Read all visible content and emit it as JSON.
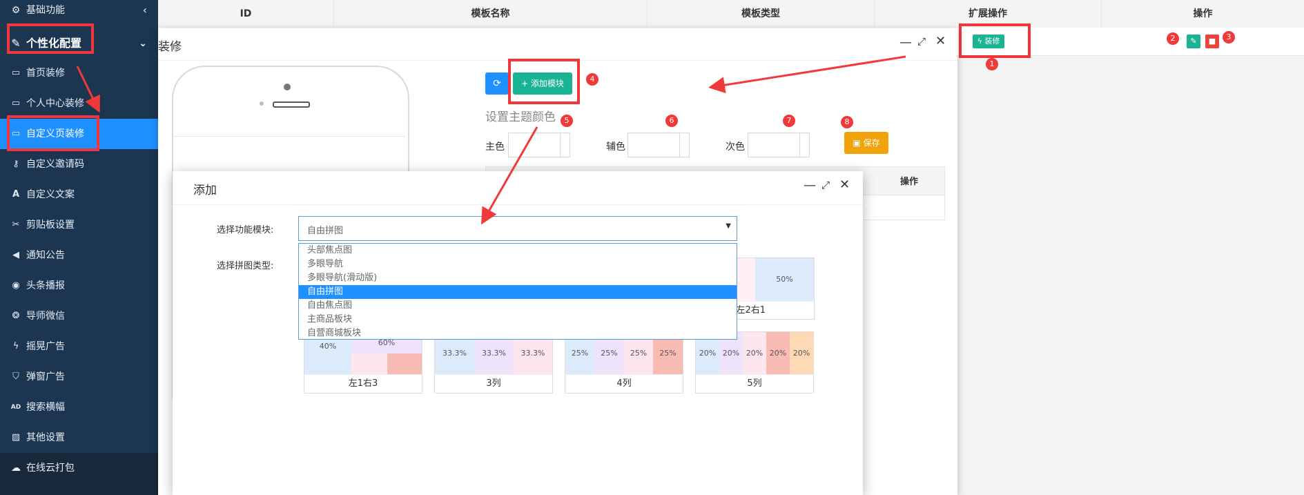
{
  "sidebar": {
    "top_group": "基础功能",
    "collapse_glyph": "‹",
    "group": "个性化配置",
    "expand_glyph": "⌄",
    "items": [
      {
        "label": "首页装修"
      },
      {
        "label": "个人中心装修"
      },
      {
        "label": "自定义页装修"
      },
      {
        "label": "自定义邀请码"
      },
      {
        "label": "自定义文案"
      },
      {
        "label": "剪贴板设置"
      },
      {
        "label": "通知公告"
      },
      {
        "label": "头条播报"
      },
      {
        "label": "导师微信"
      },
      {
        "label": "摇晃广告"
      },
      {
        "label": "弹窗广告"
      },
      {
        "label": "搜索横幅"
      },
      {
        "label": "其他设置"
      }
    ],
    "bottom_group": "在线云打包",
    "icons": {
      "sidebar_top": "gears-icon",
      "group": "magic-wand-icon",
      "cloud": "cloud-icon"
    }
  },
  "table": {
    "headers": [
      "ID",
      "模板名称",
      "模板类型",
      "扩展操作",
      "操作"
    ],
    "decorate_button": "装修"
  },
  "deco_modal": {
    "title_fragment": "装修",
    "refresh_icon": "refresh-icon",
    "add_module_button": "+ 添加模块",
    "theme_color_heading": "设置主题颜色",
    "primary_label": "主色",
    "secondary_label": "辅色",
    "tertiary_label": "次色",
    "save_button": "保存",
    "op_header": "操作"
  },
  "add_modal": {
    "title": "添加",
    "module_label": "选择功能模块:",
    "selected_module": "自由拼图",
    "options": [
      "头部焦点图",
      "多眼导航",
      "多眼导航(滑动版)",
      "自由拼图",
      "自由焦点图",
      "主商品板块",
      "自营商城板块"
    ],
    "selected_index": 3,
    "puzzle_type_label": "选择拼图类型:",
    "puzzle_cards": [
      {
        "name": "左2右1",
        "cells": [
          "50%"
        ]
      },
      {
        "name": "左1右3",
        "cells": [
          "40%",
          "60%"
        ]
      },
      {
        "name": "3列",
        "cells": [
          "33.3%",
          "33.3%",
          "33.3%"
        ]
      },
      {
        "name": "4列",
        "cells": [
          "25%",
          "25%",
          "25%",
          "25%"
        ]
      },
      {
        "name": "5列",
        "cells": [
          "20%",
          "20%",
          "20%",
          "20%",
          "20%"
        ]
      }
    ]
  },
  "badges": [
    "1",
    "2",
    "3",
    "4",
    "5",
    "6",
    "7",
    "8"
  ],
  "colors": {
    "accent_red": "#f03a3a",
    "primary_blue": "#1e90ff",
    "green": "#1ab394",
    "orange": "#f0a30a",
    "sidebar_bg": "#1c3550"
  }
}
